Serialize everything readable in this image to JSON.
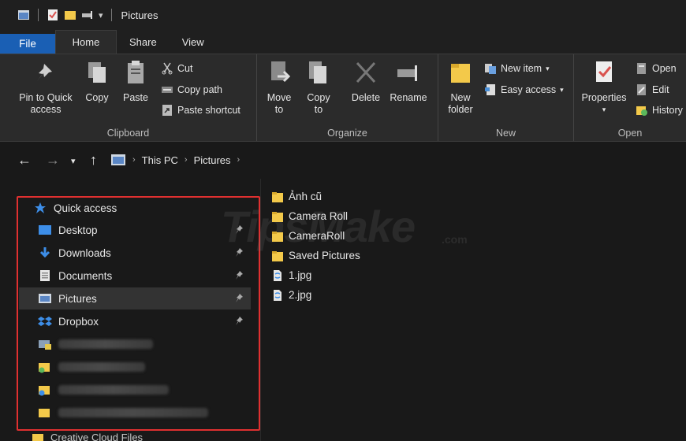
{
  "window": {
    "title": "Pictures"
  },
  "tabs": [
    "File",
    "Home",
    "Share",
    "View"
  ],
  "ribbon": {
    "clipboard": {
      "label": "Clipboard",
      "pin_to_quick_access": [
        "Pin to Quick",
        "access"
      ],
      "copy": "Copy",
      "paste": "Paste",
      "cut": "Cut",
      "copy_path": "Copy path",
      "paste_shortcut": "Paste shortcut"
    },
    "organize": {
      "label": "Organize",
      "move_to": [
        "Move",
        "to"
      ],
      "copy_to": [
        "Copy",
        "to"
      ],
      "delete": "Delete",
      "rename": "Rename"
    },
    "new": {
      "label": "New",
      "new_folder": [
        "New",
        "folder"
      ],
      "new_item": "New item",
      "easy_access": "Easy access"
    },
    "open": {
      "label": "Open",
      "properties": "Properties",
      "open": "Open",
      "edit": "Edit",
      "history": "History"
    }
  },
  "address": {
    "crumbs": [
      "This PC",
      "Pictures"
    ]
  },
  "sidebar": {
    "quick_access": "Quick access",
    "items": [
      "Desktop",
      "Downloads",
      "Documents",
      "Pictures",
      "Dropbox"
    ],
    "bottom_item": "Creative Cloud Files"
  },
  "files": [
    "Ảnh cũ",
    "Camera Roll",
    "CameraRoll",
    "Saved Pictures",
    "1.jpg",
    "2.jpg"
  ],
  "watermark": {
    "main": "TipsMake",
    "suffix": ".com"
  },
  "colors": {
    "accent": "#1a5fb4",
    "highlight_box": "#e03030",
    "folder": "#f3c94a"
  }
}
